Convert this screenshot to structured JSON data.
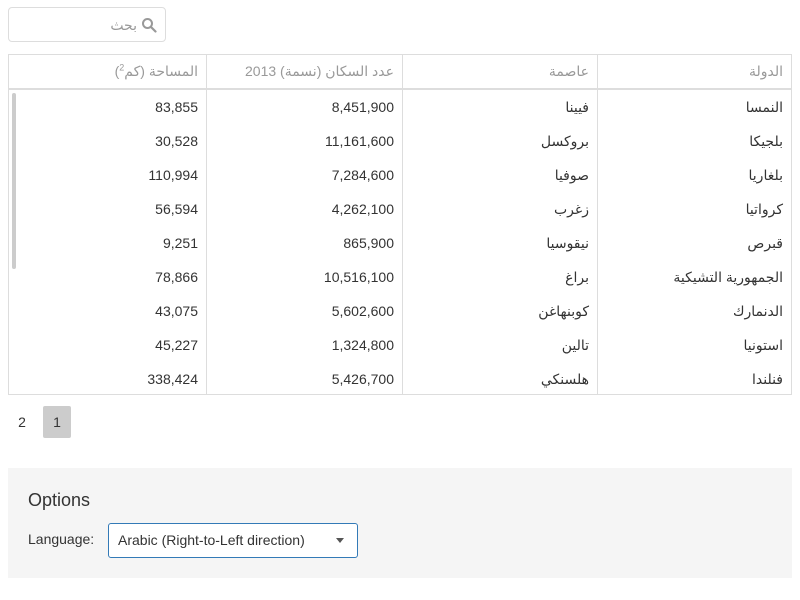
{
  "search": {
    "placeholder": "بحث"
  },
  "grid": {
    "columns": [
      {
        "label": "الدولة"
      },
      {
        "label": "عاصمة"
      },
      {
        "label": "عدد السكان (نسمة) 2013"
      },
      {
        "label": "المساحة (كم",
        "sup": "2",
        "suffix": ")"
      }
    ],
    "rows": [
      {
        "country": "النمسا",
        "capital": "فيينا",
        "population": "8,451,900",
        "area": "83,855"
      },
      {
        "country": "بلجيكا",
        "capital": "بروكسل",
        "population": "11,161,600",
        "area": "30,528"
      },
      {
        "country": "بلغاريا",
        "capital": "صوفيا",
        "population": "7,284,600",
        "area": "110,994"
      },
      {
        "country": "كرواتيا",
        "capital": "زغرب",
        "population": "4,262,100",
        "area": "56,594"
      },
      {
        "country": "قبرص",
        "capital": "نيقوسيا",
        "population": "865,900",
        "area": "9,251"
      },
      {
        "country": "الجمهورية التشيكية",
        "capital": "براغ",
        "population": "10,516,100",
        "area": "78,866"
      },
      {
        "country": "الدنمارك",
        "capital": "كوبنهاغن",
        "population": "5,602,600",
        "area": "43,075"
      },
      {
        "country": "استونيا",
        "capital": "تالين",
        "population": "1,324,800",
        "area": "45,227"
      },
      {
        "country": "فنلندا",
        "capital": "هلسنكي",
        "population": "5,426,700",
        "area": "338,424"
      }
    ]
  },
  "pager": {
    "pages": [
      "2",
      "1"
    ],
    "active": "1"
  },
  "options": {
    "title": "Options",
    "language_label": "Language:",
    "language_value": "Arabic (Right-to-Left direction)"
  },
  "colors": {
    "accent": "#337ab7",
    "border": "#dddddd",
    "panel": "#f5f5f5"
  }
}
